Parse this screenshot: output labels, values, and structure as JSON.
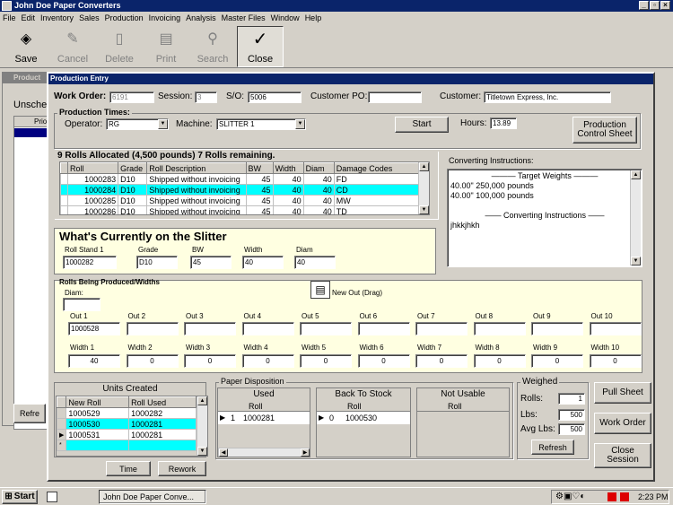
{
  "app": {
    "title": "John Doe Paper Converters"
  },
  "menu": [
    "File",
    "Edit",
    "Inventory",
    "Sales",
    "Production",
    "Invoicing",
    "Analysis",
    "Master Files",
    "Window",
    "Help"
  ],
  "toolbar": {
    "save": "Save",
    "cancel": "Cancel",
    "delete": "Delete",
    "print": "Print",
    "search": "Search",
    "close": "Close"
  },
  "bg": {
    "title": "Product",
    "tab": "Unsche",
    "col": "Prio",
    "refresh": "Refre"
  },
  "form": {
    "title": "Production Entry",
    "work_order_label": "Work Order:",
    "work_order": "6191",
    "session_label": "Session:",
    "session": "3",
    "so_label": "S/O:",
    "so": "5006",
    "po_label": "Customer PO:",
    "po": "",
    "customer_label": "Customer:",
    "customer": "Titletown Express, Inc.",
    "times_title": "Production Times:",
    "operator_label": "Operator:",
    "operator": "RG",
    "machine_label": "Machine:",
    "machine": "SLITTER 1",
    "start": "Start",
    "hours_label": "Hours:",
    "hours": "13.89",
    "pcs": "Production Control Sheet",
    "alloc_title": "9 Rolls Allocated (4,500 pounds)  7 Rolls remaining.",
    "alloc_headers": [
      "Roll",
      "Grade",
      "Roll Description",
      "BW",
      "Width",
      "Diam",
      "Damage Codes"
    ],
    "alloc_rows": [
      [
        "1000283",
        "D10",
        "Shipped without invoicing",
        "45",
        "40",
        "40",
        "FD"
      ],
      [
        "1000284",
        "D10",
        "Shipped without invoicing",
        "45",
        "40",
        "40",
        "CD"
      ],
      [
        "1000285",
        "D10",
        "Shipped without invoicing",
        "45",
        "40",
        "40",
        "MW"
      ],
      [
        "1000286",
        "D10",
        "Shipped without invoicing",
        "45",
        "40",
        "40",
        "TD"
      ]
    ],
    "conv_label": "Converting Instructions:",
    "conv_lines": [
      "——— Target Weights ———",
      "40.00\" 250,000 pounds",
      "40.00\" 100,000 pounds",
      "",
      "—— Converting Instructions ——",
      "jhkkjhkh"
    ],
    "current_title": "What's Currently on the Slitter",
    "rs_label": "Roll Stand 1",
    "rs": "1000282",
    "grade_label": "Grade",
    "grade": "D10",
    "bw_label": "BW",
    "bw": "45",
    "width_label": "Width",
    "width": "40",
    "diam_label": "Diam",
    "diam": "40",
    "produced_title": "Rolls Being Produced/Widths",
    "diam2_label": "Diam:",
    "diam2": "",
    "newout": "New Out (Drag)",
    "outs": [
      {
        "label": "Out 1",
        "value": "1000528"
      },
      {
        "label": "Out 2",
        "value": ""
      },
      {
        "label": "Out 3",
        "value": ""
      },
      {
        "label": "Out 4",
        "value": ""
      },
      {
        "label": "Out 5",
        "value": ""
      },
      {
        "label": "Out 6",
        "value": ""
      },
      {
        "label": "Out 7",
        "value": ""
      },
      {
        "label": "Out 8",
        "value": ""
      },
      {
        "label": "Out 9",
        "value": ""
      },
      {
        "label": "Out 10",
        "value": ""
      }
    ],
    "widths": [
      {
        "label": "Width 1",
        "value": "40"
      },
      {
        "label": "Width 2",
        "value": "0"
      },
      {
        "label": "Width 3",
        "value": "0"
      },
      {
        "label": "Width 4",
        "value": "0"
      },
      {
        "label": "Width 5",
        "value": "0"
      },
      {
        "label": "Width 6",
        "value": "0"
      },
      {
        "label": "Width 7",
        "value": "0"
      },
      {
        "label": "Width 8",
        "value": "0"
      },
      {
        "label": "Width 9",
        "value": "0"
      },
      {
        "label": "Width 10",
        "value": "0"
      }
    ],
    "units_title": "Units Created",
    "units_headers": [
      "New Roll",
      "Roll Used"
    ],
    "units_rows": [
      [
        "1000529",
        "1000282"
      ],
      [
        "1000530",
        "1000281"
      ],
      [
        "1000531",
        "1000281"
      ]
    ],
    "time": "Time",
    "rework": "Rework",
    "disp_title": "Paper Disposition",
    "used_title": "Used",
    "used_header": "Roll",
    "used_num": "1",
    "used_roll": "1000281",
    "back_title": "Back To Stock",
    "back_header": "Roll",
    "back_num": "0",
    "back_roll": "1000530",
    "notusable_title": "Not Usable",
    "notusable_header": "Roll",
    "weighed_title": "Weighed",
    "rolls_label": "Rolls:",
    "rolls": "1",
    "lbs_label": "Lbs:",
    "lbs": "500",
    "avg_label": "Avg Lbs:",
    "avg": "500",
    "refresh": "Refresh",
    "pull": "Pull Sheet",
    "workorder": "Work Order",
    "closesession": "Close Session"
  },
  "taskbar": {
    "start": "Start",
    "task": "John Doe Paper Conve...",
    "clock": "2:23 PM"
  }
}
